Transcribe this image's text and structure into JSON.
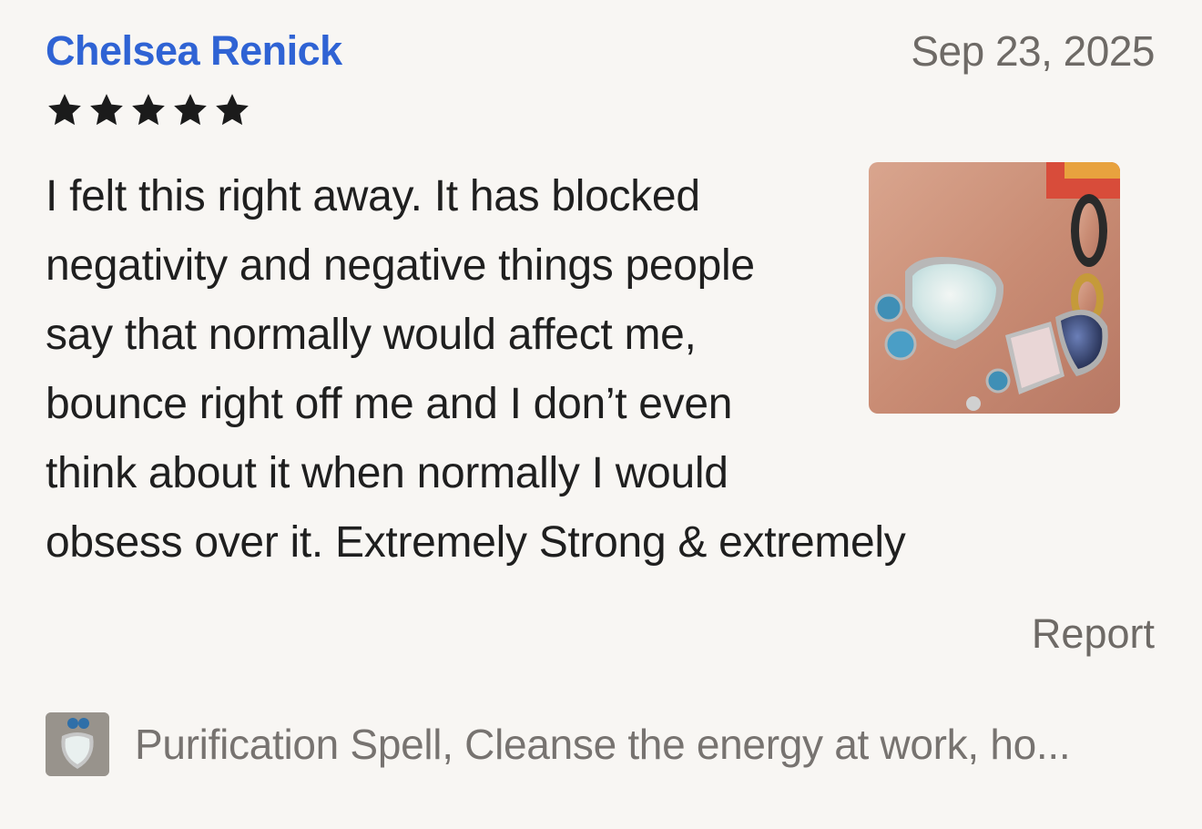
{
  "review": {
    "reviewer_name": "Chelsea Renick",
    "date": "Sep 23, 2025",
    "rating": 5,
    "star_color": "#1b1b1b",
    "text": "I felt this right away. It has blocked negativity and negative things people say that normally would affect me, bounce right off me and I don’t even think about it when normally I would obsess over it. Extremely Strong & extremely",
    "report_label": "Report",
    "photo_icon": "review-photo-jewelry"
  },
  "product": {
    "title": "Purification Spell, Cleanse the energy at work, ho...",
    "thumbnail_icon": "product-thumbnail-pendant"
  },
  "colors": {
    "background": "#f8f6f3",
    "reviewer_link": "#2f63d4",
    "muted_text": "#6e6a66"
  }
}
